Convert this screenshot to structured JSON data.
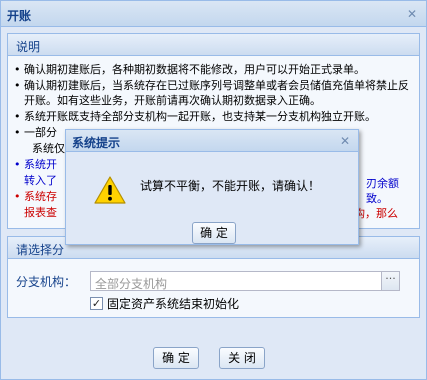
{
  "window": {
    "title": "开账",
    "close_icon": "close-icon"
  },
  "notes_panel": {
    "legend": "说明",
    "items": [
      "确认期初建账后，各种期初数据将不能修改，用户可以开始正式录单。",
      "确认期初建账后，当系统存在已过账序列号调整单或者会员储值充值单将禁止反开账。如有这些业务，开账前请再次确认期初数据录入正确。",
      "系统开账既支持全部分支机构一起开账，也支持某一分支机构独立开账。",
      "一部分",
      "系统仅",
      "系统开",
      "转入了",
      "系统存",
      "报表查"
    ],
    "items_right": [
      "刃余额",
      "致。",
      "构，那么"
    ]
  },
  "select_panel": {
    "legend": "请选择分",
    "branch_label": "分支机构：",
    "branch_value": "全部分支机构",
    "trigger_glyph": "···",
    "checkbox_label": "固定资产系统结束初始化",
    "checkbox_checked": true
  },
  "buttons": {
    "ok": "确 定",
    "close": "关 闭"
  },
  "dialog": {
    "title": "系统提示",
    "message": "试算不平衡，不能开账，请确认！",
    "ok": "确 定",
    "icon": "warning-icon"
  },
  "colors": {
    "accent": "#15428b",
    "border": "#99bbe8",
    "blue_note": "#0000cc",
    "red_note": "#cc0000"
  }
}
